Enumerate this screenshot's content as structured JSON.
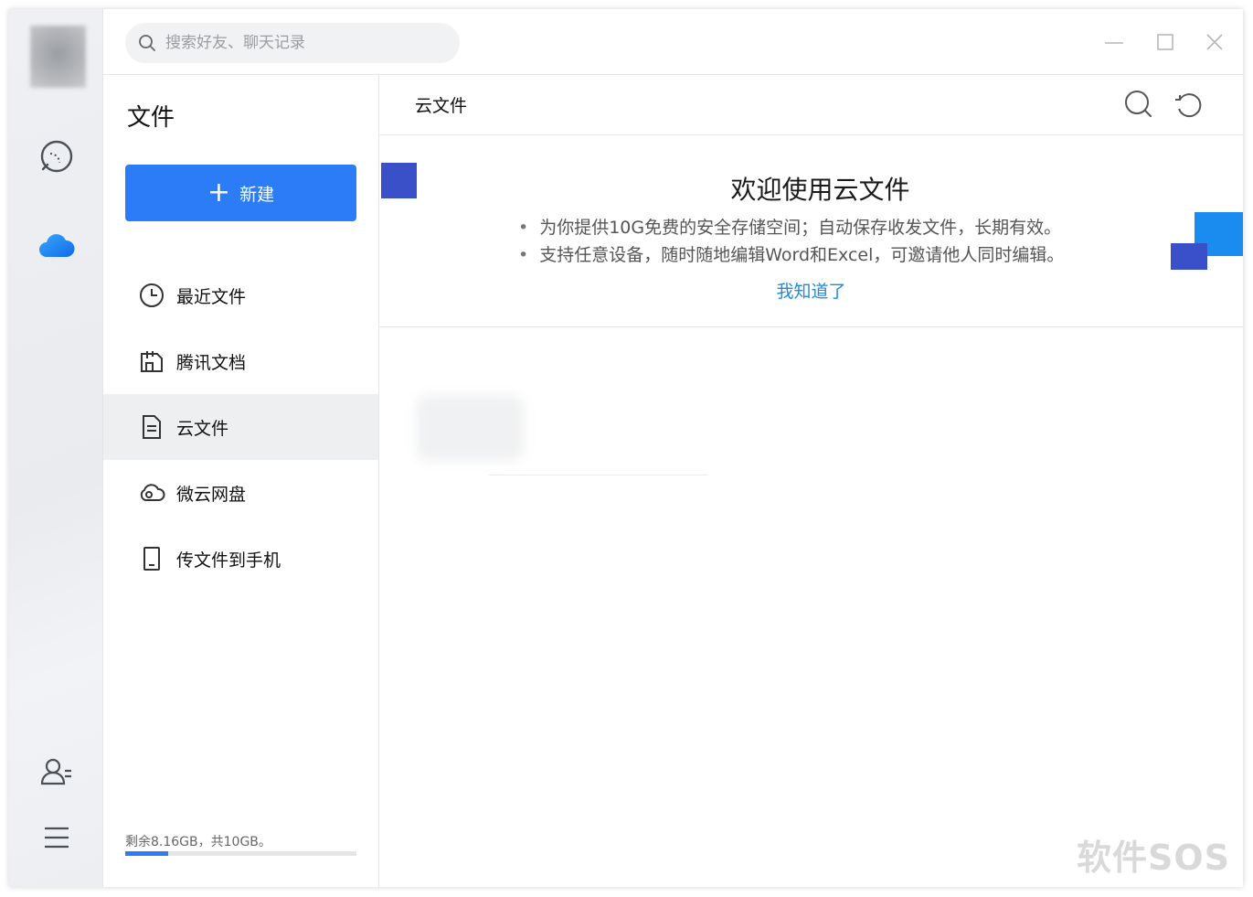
{
  "search": {
    "placeholder": "搜索好友、聊天记录"
  },
  "rail": {
    "icons": [
      "chat-icon",
      "cloud-icon",
      "contacts-icon",
      "menu-icon"
    ]
  },
  "panel": {
    "title": "文件",
    "new_button": {
      "plus": "+",
      "label": "新建"
    },
    "nav": [
      {
        "label": "最近文件",
        "icon": "clock-icon"
      },
      {
        "label": "腾讯文档",
        "icon": "tencent-docs-icon"
      },
      {
        "label": "云文件",
        "icon": "document-icon",
        "active": true
      },
      {
        "label": "微云网盘",
        "icon": "weiyun-icon"
      },
      {
        "label": "传文件到手机",
        "icon": "phone-icon"
      }
    ],
    "storage": {
      "text": "剩余8.16GB，共10GB。",
      "used_fraction": 0.184
    }
  },
  "main": {
    "title": "云文件",
    "banner": {
      "title": "欢迎使用云文件",
      "items": [
        "为你提供10G免费的安全存储空间；自动保存收发文件，长期有效。",
        "支持任意设备，随时随地编辑Word和Excel，可邀请他人同时编辑。"
      ],
      "link": "我知道了"
    }
  },
  "watermark": "软件SOS",
  "colors": {
    "accent": "#2b7cf6",
    "link": "#1f8be0",
    "deco_dark": "#3a50c8",
    "deco_light": "#1a8cf0"
  }
}
